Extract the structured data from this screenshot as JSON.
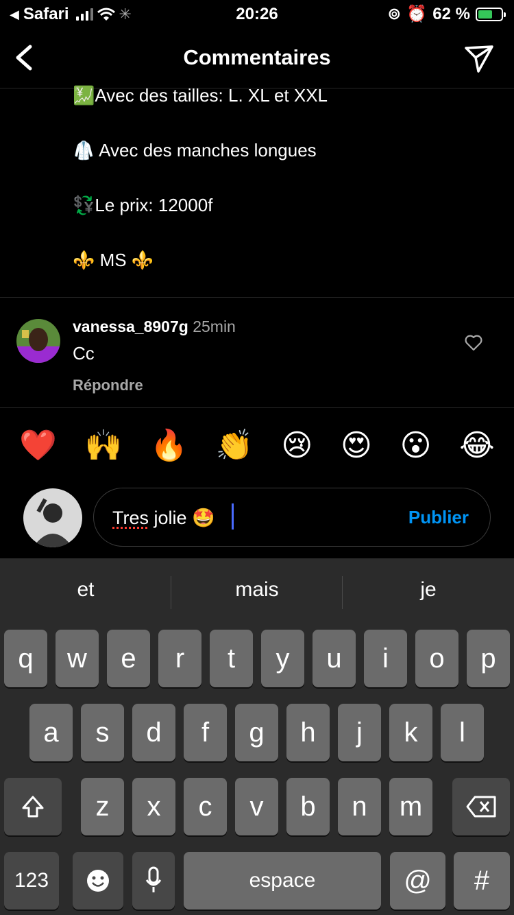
{
  "status_bar": {
    "back_app": "Safari",
    "time": "20:26",
    "battery_pct": "62 %",
    "battery_level": 0.62,
    "battery_color": "#35c759"
  },
  "header": {
    "title": "Commentaires",
    "back_icon": "chevron-left-icon",
    "send_icon": "paper-plane-icon"
  },
  "caption": {
    "lines": [
      {
        "emoji": "💹",
        "text": "Avec des tailles: L. XL et  XXL"
      },
      {
        "emoji": "🥼",
        "text": " Avec des manches longues"
      },
      {
        "emoji": "💱",
        "text": "Le prix: 12000f"
      },
      {
        "emoji": "⚜️",
        "text": " MS ⚜️"
      }
    ]
  },
  "comment": {
    "username": "vanessa_8907g",
    "time": "25min",
    "text": "Cc",
    "reply_label": "Répondre"
  },
  "reactions": [
    "❤️",
    "🙌",
    "🔥",
    "👏",
    "😢",
    "😍",
    "😮",
    "😂"
  ],
  "composer": {
    "text_misspelled": "Tres",
    "text_rest": " jolie 🤩",
    "publish_label": "Publier",
    "accent": "#0095f6"
  },
  "keyboard": {
    "suggestions": [
      "et",
      "mais",
      "je"
    ],
    "row1": [
      "q",
      "w",
      "e",
      "r",
      "t",
      "y",
      "u",
      "i",
      "o",
      "p"
    ],
    "row2": [
      "a",
      "s",
      "d",
      "f",
      "g",
      "h",
      "j",
      "k",
      "l"
    ],
    "row3": [
      "z",
      "x",
      "c",
      "v",
      "b",
      "n",
      "m"
    ],
    "numbers_label": "123",
    "space_label": "espace",
    "at_label": "@",
    "hash_label": "#"
  }
}
